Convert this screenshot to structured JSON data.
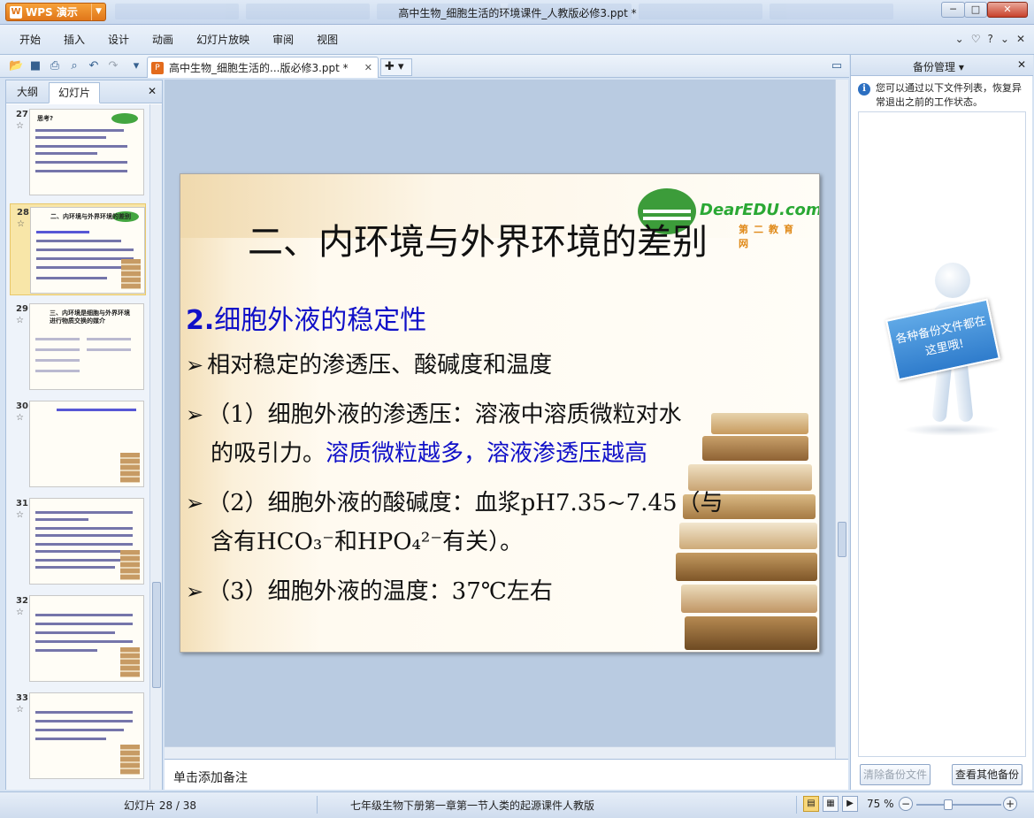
{
  "app": {
    "name": "WPS 演示",
    "window_title": "高中生物_细胞生活的环境课件_人教版必修3.ppt *",
    "controls": {
      "minimize": "─",
      "maximize": "□",
      "close": "✕"
    }
  },
  "menu": {
    "items": [
      "开始",
      "插入",
      "设计",
      "动画",
      "幻灯片放映",
      "审阅",
      "视图"
    ],
    "right": [
      "⌄",
      "♡",
      "?",
      "⌄",
      "✕"
    ]
  },
  "toolbar": {
    "doc_tab_label": "高中生物_细胞生活的...版必修3.ppt *",
    "new_tab": "✚ ▾"
  },
  "left_pane": {
    "tabs": [
      "大纲",
      "幻灯片"
    ],
    "active_tab": "幻灯片",
    "thumbnails": [
      {
        "num": "27",
        "title": "思考?"
      },
      {
        "num": "28",
        "title": "二、内环境与外界环境的差别",
        "selected": true
      },
      {
        "num": "29",
        "title": "三、内环境是细胞与外界环境进行物质交换的媒介"
      },
      {
        "num": "30",
        "title": ""
      },
      {
        "num": "31",
        "title": ""
      },
      {
        "num": "32",
        "title": ""
      },
      {
        "num": "33",
        "title": ""
      }
    ]
  },
  "slide": {
    "title": "二、内环境与外界环境的差别",
    "logo_text": "DearEDU.com",
    "logo_sub": "第二教育网",
    "subhead_num": "2.",
    "subhead_text": "细胞外液的稳定性",
    "bullet1": "相对稳定的渗透压、酸碱度和温度",
    "bullet2a": "（1）细胞外液的渗透压：溶液中溶质微粒对水",
    "bullet2b": "的吸引力。",
    "bullet2c": "溶质微粒越多，溶液渗透压越高",
    "bullet3a": "（2）细胞外液的酸碱度：血浆pH7.35~7.45（与",
    "bullet3b": "含有HCO₃⁻和HPO₄²⁻有关）。",
    "bullet4": "（3）细胞外液的温度：37℃左右"
  },
  "notes": {
    "placeholder": "单击添加备注"
  },
  "right_pane": {
    "title": "备份管理 ▾",
    "info": "您可以通过以下文件列表，恢复异常退出之前的工作状态。",
    "sign_text": "各种备份文件都在这里哦!",
    "btn_clear": "清除备份文件",
    "btn_view": "查看其他备份"
  },
  "status": {
    "page": "幻灯片 28 / 38",
    "doc_name": "七年级生物下册第一章第一节人类的起源课件人教版",
    "zoom": "75 %",
    "zoom_level": 0.38
  },
  "colors": {
    "accent_blue": "#1010c8",
    "wps_orange": "#e0761a",
    "thumb_selected": "#f8e6a8"
  }
}
